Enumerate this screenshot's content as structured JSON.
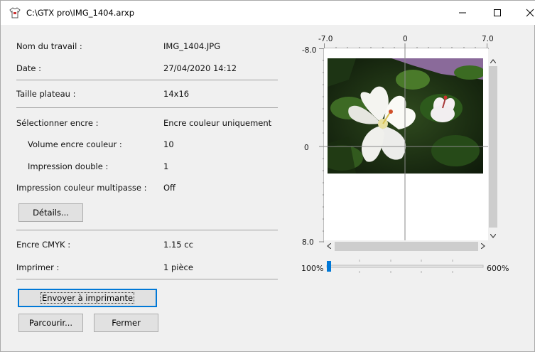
{
  "window": {
    "title": "C:\\GTX pro\\IMG_1404.arxp",
    "minimize_icon": "minimize-icon",
    "maximize_icon": "maximize-icon",
    "close_icon": "close-icon"
  },
  "info": {
    "job_name_label": "Nom du travail :",
    "job_name_value": "IMG_1404.JPG",
    "date_label": "Date :",
    "date_value": "27/04/2020 14:12",
    "platen_label": "Taille plateau :",
    "platen_value": "14x16",
    "ink_select_label": "Sélectionner encre :",
    "ink_select_value": "Encre couleur uniquement",
    "color_ink_volume_label": "Volume encre couleur :",
    "color_ink_volume_value": "10",
    "double_print_label": "Impression double :",
    "double_print_value": "1",
    "multipass_label": "Impression couleur multipasse :",
    "multipass_value": "Off",
    "details_button": "Détails...",
    "cmyk_label": "Encre CMYK :",
    "cmyk_value": "1.15 cc",
    "print_label": "Imprimer :",
    "print_value": "1 pièce"
  },
  "actions": {
    "send_button": "Envoyer à imprimante",
    "browse_button": "Parcourir...",
    "close_button": "Fermer"
  },
  "preview": {
    "ruler_x_left": "-7.0",
    "ruler_x_mid": "0",
    "ruler_x_right": "7.0",
    "ruler_y_top": "-8.0",
    "ruler_y_mid": "0",
    "ruler_y_bottom": "8.0",
    "image_subject": "white hibiscus flower photo"
  },
  "zoom": {
    "min_label": "100%",
    "max_label": "600%",
    "value_fraction": 0.0
  }
}
